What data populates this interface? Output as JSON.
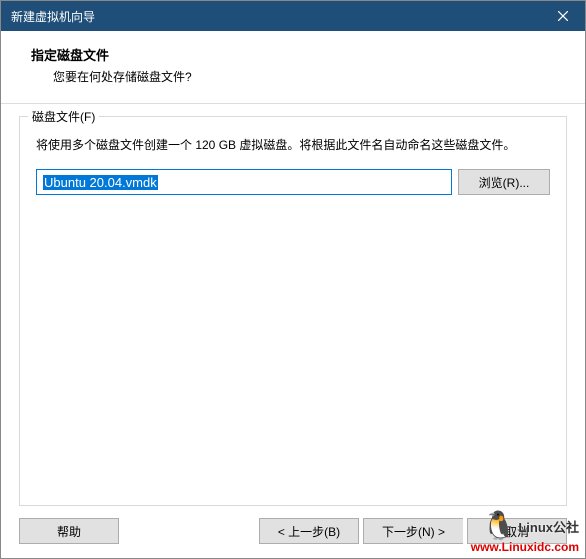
{
  "titlebar": {
    "title": "新建虚拟机向导"
  },
  "header": {
    "title": "指定磁盘文件",
    "subtitle": "您要在何处存储磁盘文件?"
  },
  "group": {
    "label": "磁盘文件(F)",
    "description": "将使用多个磁盘文件创建一个 120 GB 虚拟磁盘。将根据此文件名自动命名这些磁盘文件。",
    "filename": "Ubuntu 20.04.vmdk",
    "browse": "浏览(R)..."
  },
  "footer": {
    "help": "帮助",
    "back": "< 上一步(B)",
    "next": "下一步(N) >",
    "cancel": "取消"
  },
  "watermark": {
    "brand": "Linux公社",
    "url": "www.Linuxidc.com"
  }
}
